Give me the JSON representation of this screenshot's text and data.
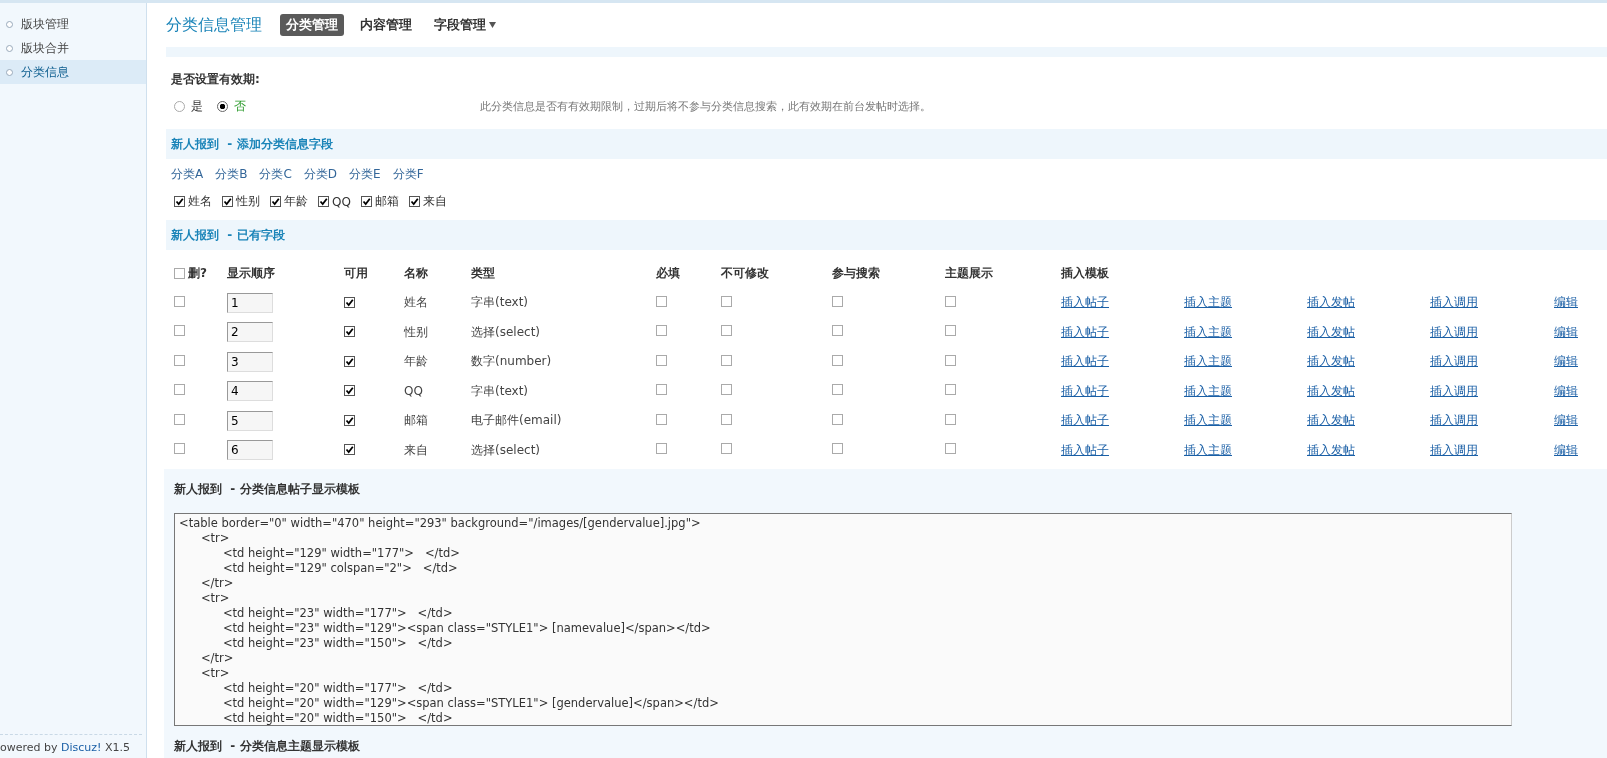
{
  "sidebar": {
    "items": [
      {
        "label": "版块管理",
        "selected": false
      },
      {
        "label": "版块合并",
        "selected": false
      },
      {
        "label": "分类信息",
        "selected": true
      }
    ],
    "footer": {
      "prefix": "owered by",
      "link": "Discuz!",
      "version": "X1.5"
    }
  },
  "header": {
    "title": "分类信息管理",
    "tabs": [
      {
        "label": "分类管理",
        "selected": true,
        "kind": "tab"
      },
      {
        "label": "内容管理",
        "selected": false,
        "kind": "tab"
      },
      {
        "label": "字段管理",
        "selected": false,
        "kind": "dropdown"
      }
    ]
  },
  "expiry": {
    "question": "是否设置有效期:",
    "options": [
      {
        "label": "是",
        "selected": false
      },
      {
        "label": "否",
        "selected": true
      }
    ],
    "hint": "此分类信息是否有有效期限制，过期后将不参与分类信息搜索，此有效期在前台发帖时选择。"
  },
  "add_fields": {
    "heading": "新人报到  - 添加分类信息字段",
    "categories": [
      "分类A",
      "分类B",
      "分类C",
      "分类D",
      "分类E",
      "分类F"
    ],
    "fields": [
      {
        "label": "姓名",
        "checked": true
      },
      {
        "label": "性别",
        "checked": true
      },
      {
        "label": "年龄",
        "checked": true
      },
      {
        "label": "QQ",
        "checked": true
      },
      {
        "label": "邮箱",
        "checked": true
      },
      {
        "label": "来自",
        "checked": true
      }
    ]
  },
  "existing": {
    "heading": "新人报到  - 已有字段",
    "delete_all_checked": false,
    "columns": [
      "删?",
      "显示顺序",
      "可用",
      "名称",
      "类型",
      "必填",
      "不可修改",
      "参与搜索",
      "主题展示",
      "插入模板"
    ],
    "rows": [
      {
        "delete": false,
        "order": "1",
        "enabled": true,
        "name": "姓名",
        "type": "字串(text)",
        "required": false,
        "readonly": false,
        "searchable": false,
        "show_in_thread": false,
        "links": [
          "插入帖子",
          "插入主题",
          "插入发帖",
          "插入调用",
          "编辑"
        ]
      },
      {
        "delete": false,
        "order": "2",
        "enabled": true,
        "name": "性别",
        "type": "选择(select)",
        "required": false,
        "readonly": false,
        "searchable": false,
        "show_in_thread": false,
        "links": [
          "插入帖子",
          "插入主题",
          "插入发帖",
          "插入调用",
          "编辑"
        ]
      },
      {
        "delete": false,
        "order": "3",
        "enabled": true,
        "name": "年龄",
        "type": "数字(number)",
        "required": false,
        "readonly": false,
        "searchable": false,
        "show_in_thread": false,
        "links": [
          "插入帖子",
          "插入主题",
          "插入发帖",
          "插入调用",
          "编辑"
        ]
      },
      {
        "delete": false,
        "order": "4",
        "enabled": true,
        "name": "QQ",
        "type": "字串(text)",
        "required": false,
        "readonly": false,
        "searchable": false,
        "show_in_thread": false,
        "links": [
          "插入帖子",
          "插入主题",
          "插入发帖",
          "插入调用",
          "编辑"
        ]
      },
      {
        "delete": false,
        "order": "5",
        "enabled": true,
        "name": "邮箱",
        "type": "电子邮件(email)",
        "required": false,
        "readonly": false,
        "searchable": false,
        "show_in_thread": false,
        "links": [
          "插入帖子",
          "插入主题",
          "插入发帖",
          "插入调用",
          "编辑"
        ]
      },
      {
        "delete": false,
        "order": "6",
        "enabled": true,
        "name": "来自",
        "type": "选择(select)",
        "required": false,
        "readonly": false,
        "searchable": false,
        "show_in_thread": false,
        "links": [
          "插入帖子",
          "插入主题",
          "插入发帖",
          "插入调用",
          "编辑"
        ]
      }
    ]
  },
  "templates": [
    {
      "heading": "新人报到  - 分类信息帖子显示模板",
      "code": "<table border=\"0\" width=\"470\" height=\"293\" background=\"/images/[gendervalue].jpg\">\n\t<tr>\n\t\t<td height=\"129\" width=\"177\">   </td>\n\t\t<td height=\"129\" colspan=\"2\">   </td>\n\t</tr>\n\t<tr>\n\t\t<td height=\"23\" width=\"177\">   </td>\n\t\t<td height=\"23\" width=\"129\"><span class=\"STYLE1\"> [namevalue]</span></td>\n\t\t<td height=\"23\" width=\"150\">   </td>\n\t</tr>\n\t<tr>\n\t\t<td height=\"20\" width=\"177\">   </td>\n\t\t<td height=\"20\" width=\"129\"><span class=\"STYLE1\"> [gendervalue]</span></td>\n\t\t<td height=\"20\" width=\"150\">   </td>"
    },
    {
      "heading": "新人报到  - 分类信息主题显示模板"
    }
  ]
}
